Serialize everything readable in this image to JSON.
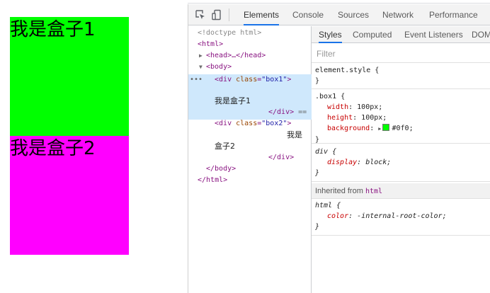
{
  "page": {
    "boxes": [
      {
        "text": "我是盒子1",
        "color": "#00ff00"
      },
      {
        "text": "我是盒子2",
        "color": "#ff00ff"
      }
    ]
  },
  "devtools": {
    "main_tabs": [
      "Elements",
      "Console",
      "Sources",
      "Network",
      "Performance"
    ],
    "active_tab": "Elements",
    "dom": {
      "doctype": "<!doctype html>",
      "html_open": "<html>",
      "head": "<head>…</head>",
      "body_open": "<body>",
      "box1_tag": "div",
      "box1_attr": "class",
      "box1_class": "\"box1\"",
      "box1_text": "我是盒子1",
      "div_close": "</div>",
      "eq_marker": "==",
      "box2_class": "\"box2\"",
      "box2_text_a": "我是",
      "box2_text_b": "盒子2",
      "body_close": "</body>",
      "html_close": "</html>",
      "dots": "•••"
    },
    "style_tabs": [
      "Styles",
      "Computed",
      "Event Listeners",
      "DOM"
    ],
    "active_style_tab": "Styles",
    "filter_placeholder": "Filter",
    "rules": {
      "element_style": "element.style {",
      "close_brace": "}",
      "box1_selector": ".box1 {",
      "width_prop": "width",
      "width_val": "100px;",
      "height_prop": "height",
      "height_val": "100px;",
      "bg_prop": "background",
      "bg_val": "#0f0;",
      "bg_swatch": "#00ff00",
      "div_selector": "div {",
      "display_prop": "display",
      "display_val": "block;",
      "inherited_label": "Inherited from",
      "inherited_from": "html",
      "html_selector": "html {",
      "color_prop": "color",
      "color_val": "-internal-root-color;"
    }
  }
}
